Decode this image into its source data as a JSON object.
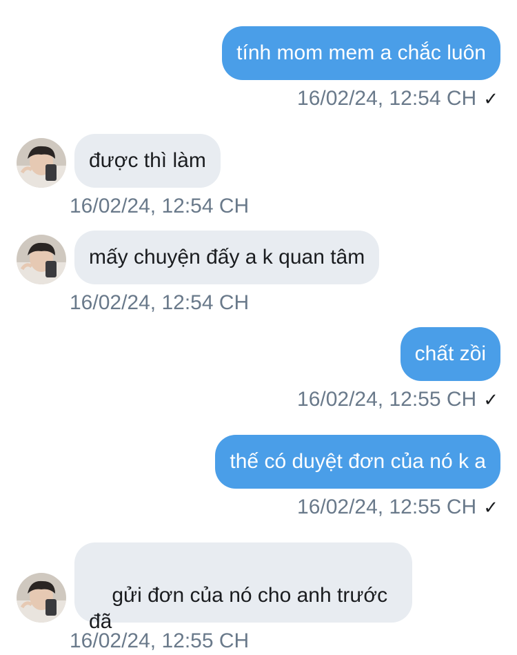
{
  "messages": [
    {
      "direction": "outgoing",
      "text": "tính mom mem a chắc luôn",
      "time": "16/02/24, 12:54 CH",
      "status": "sent-check-icon"
    },
    {
      "direction": "incoming",
      "text": "được thì làm",
      "time": "16/02/24, 12:54 CH"
    },
    {
      "direction": "incoming",
      "text": "mấy chuyện đấy a k quan tâm",
      "time": "16/02/24, 12:54 CH"
    },
    {
      "direction": "outgoing",
      "text": "chất zồi",
      "time": "16/02/24, 12:55 CH",
      "status": "sent-check-icon"
    },
    {
      "direction": "outgoing",
      "text": "thế có duyệt đơn của nó k a",
      "time": "16/02/24, 12:55 CH",
      "status": "sent-check-icon"
    },
    {
      "direction": "incoming",
      "text": "  gửi đơn của nó cho anh trước\nđã",
      "time": "16/02/24, 12:55 CH"
    }
  ],
  "check_glyph": "✓",
  "colors": {
    "outgoing_bubble": "#4a9ee8",
    "incoming_bubble": "#e8ecf1",
    "timestamp": "#69798a"
  }
}
